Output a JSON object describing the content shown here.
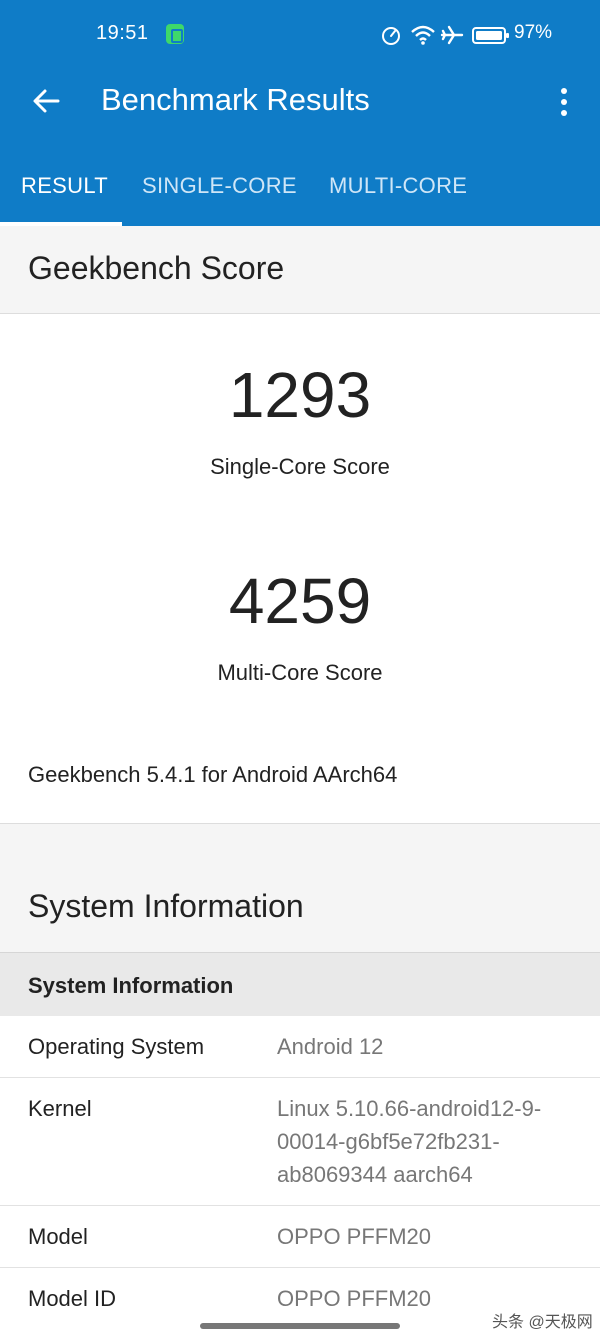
{
  "status_bar": {
    "time": "19:51",
    "battery": "97%",
    "icons": [
      "app-notification-icon",
      "data-saver-icon",
      "wifi-icon",
      "airplane-icon",
      "battery-icon"
    ]
  },
  "app_bar": {
    "title": "Benchmark Results",
    "back_icon": "arrow-left-icon",
    "menu_icon": "more-vertical-icon",
    "color": "#0f7cc7"
  },
  "tabs": [
    {
      "label": "RESULT",
      "active": true
    },
    {
      "label": "SINGLE-CORE",
      "active": false
    },
    {
      "label": "MULTI-CORE",
      "active": false
    }
  ],
  "geekbench_score": {
    "heading": "Geekbench Score",
    "single_core": {
      "value": "1293",
      "label": "Single-Core Score"
    },
    "multi_core": {
      "value": "4259",
      "label": "Multi-Core Score"
    },
    "version": "Geekbench 5.4.1 for Android AArch64"
  },
  "system_information": {
    "heading": "System Information",
    "table_header": "System Information",
    "rows": [
      {
        "key": "Operating System",
        "value": "Android 12"
      },
      {
        "key": "Kernel",
        "value": "Linux 5.10.66-android12-9-00014-g6bf5e72fb231-ab8069344 aarch64"
      },
      {
        "key": "Model",
        "value": "OPPO PFFM20"
      },
      {
        "key": "Model ID",
        "value": "OPPO PFFM20"
      }
    ]
  },
  "watermark": "头条 @天极网"
}
